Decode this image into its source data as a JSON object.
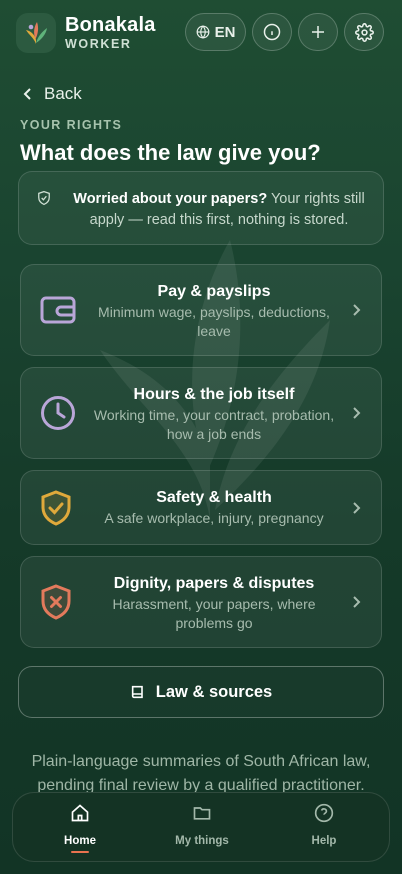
{
  "brand": {
    "title": "Bonakala",
    "subtitle": "WORKER"
  },
  "header": {
    "language": "EN",
    "icons": [
      "globe-icon",
      "info-icon",
      "plus-icon",
      "gear-icon"
    ]
  },
  "nav_back": {
    "label": "Back"
  },
  "section": {
    "kicker": "YOUR RIGHTS",
    "title": "What does the law give you?"
  },
  "notice": {
    "bold": "Worried about your papers?",
    "text": " Your rights still apply — read this first, nothing is stored."
  },
  "cards": [
    {
      "title": "Pay & payslips",
      "subtitle": "Minimum wage, payslips, deductions, leave",
      "icon": "wallet-icon",
      "icon_color": "#b9a6d8"
    },
    {
      "title": "Hours & the job itself",
      "subtitle": "Working time, your contract, probation, how a job ends",
      "icon": "clock-icon",
      "icon_color": "#b9a6d8"
    },
    {
      "title": "Safety & health",
      "subtitle": "A safe workplace, injury, pregnancy",
      "icon": "shield-check-icon",
      "icon_color": "#e0a93b"
    },
    {
      "title": "Dignity, papers & disputes",
      "subtitle": "Harassment, your papers, where problems go",
      "icon": "shield-x-icon",
      "icon_color": "#e37a5c"
    }
  ],
  "law_button": {
    "label": "Law & sources"
  },
  "footer_note": "Plain-language summaries of South African law, pending final review by a qualified practitioner.",
  "bottom_nav": [
    {
      "label": "Home",
      "icon": "home-icon",
      "active": true
    },
    {
      "label": "My things",
      "icon": "folder-icon",
      "active": false
    },
    {
      "label": "Help",
      "icon": "help-icon",
      "active": false
    }
  ],
  "colors": {
    "accent": "#e8734f",
    "background": "#1a4430"
  }
}
